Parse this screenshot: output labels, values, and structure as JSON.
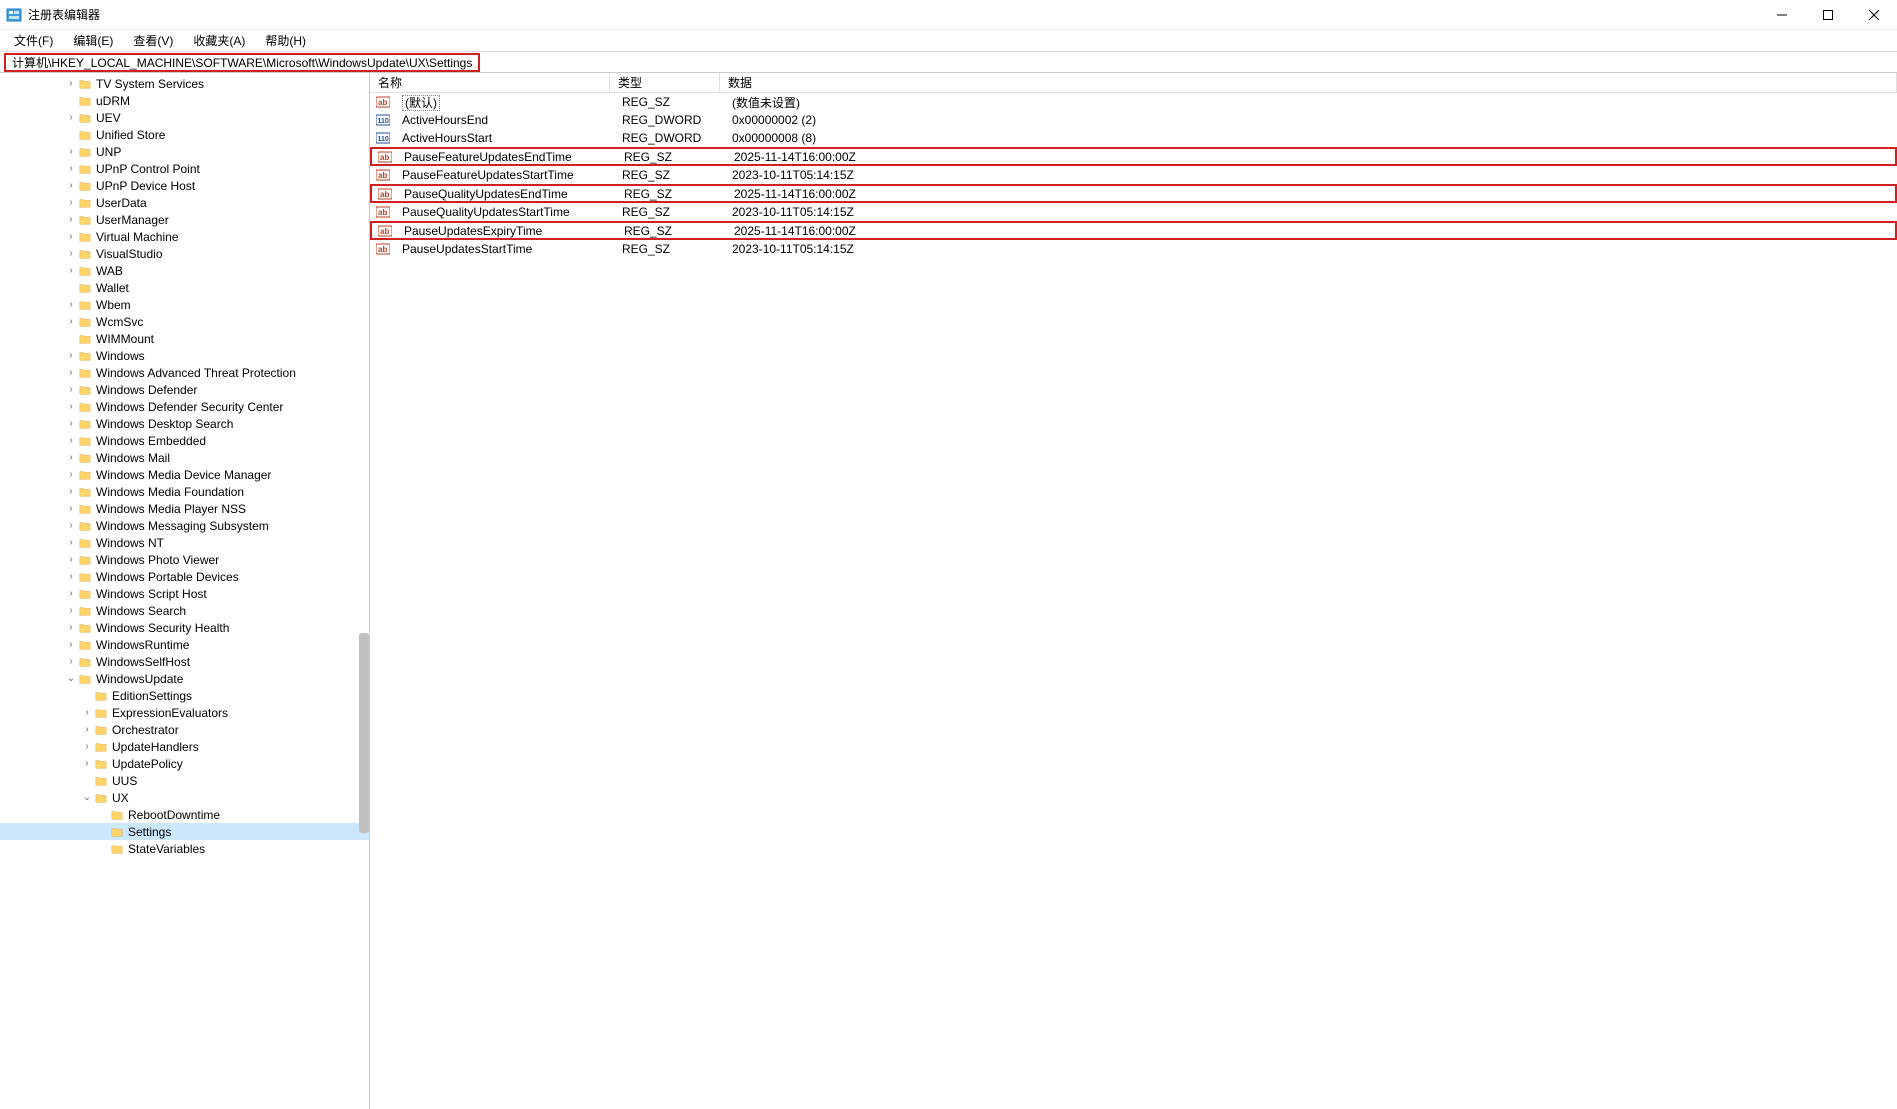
{
  "window": {
    "title": "注册表编辑器"
  },
  "menu": {
    "file": "文件(F)",
    "edit": "编辑(E)",
    "view": "查看(V)",
    "favorites": "收藏夹(A)",
    "help": "帮助(H)"
  },
  "address": {
    "path": "计算机\\HKEY_LOCAL_MACHINE\\SOFTWARE\\Microsoft\\WindowsUpdate\\UX\\Settings"
  },
  "tree": [
    {
      "indent": 4,
      "exp": ">",
      "label": "TV System Services"
    },
    {
      "indent": 4,
      "exp": "",
      "label": "uDRM"
    },
    {
      "indent": 4,
      "exp": ">",
      "label": "UEV"
    },
    {
      "indent": 4,
      "exp": "",
      "label": "Unified Store"
    },
    {
      "indent": 4,
      "exp": ">",
      "label": "UNP"
    },
    {
      "indent": 4,
      "exp": ">",
      "label": "UPnP Control Point"
    },
    {
      "indent": 4,
      "exp": ">",
      "label": "UPnP Device Host"
    },
    {
      "indent": 4,
      "exp": ">",
      "label": "UserData"
    },
    {
      "indent": 4,
      "exp": ">",
      "label": "UserManager"
    },
    {
      "indent": 4,
      "exp": ">",
      "label": "Virtual Machine"
    },
    {
      "indent": 4,
      "exp": ">",
      "label": "VisualStudio"
    },
    {
      "indent": 4,
      "exp": ">",
      "label": "WAB"
    },
    {
      "indent": 4,
      "exp": "",
      "label": "Wallet"
    },
    {
      "indent": 4,
      "exp": ">",
      "label": "Wbem"
    },
    {
      "indent": 4,
      "exp": ">",
      "label": "WcmSvc"
    },
    {
      "indent": 4,
      "exp": "",
      "label": "WIMMount"
    },
    {
      "indent": 4,
      "exp": ">",
      "label": "Windows"
    },
    {
      "indent": 4,
      "exp": ">",
      "label": "Windows Advanced Threat Protection"
    },
    {
      "indent": 4,
      "exp": ">",
      "label": "Windows Defender"
    },
    {
      "indent": 4,
      "exp": ">",
      "label": "Windows Defender Security Center"
    },
    {
      "indent": 4,
      "exp": ">",
      "label": "Windows Desktop Search"
    },
    {
      "indent": 4,
      "exp": ">",
      "label": "Windows Embedded"
    },
    {
      "indent": 4,
      "exp": ">",
      "label": "Windows Mail"
    },
    {
      "indent": 4,
      "exp": ">",
      "label": "Windows Media Device Manager"
    },
    {
      "indent": 4,
      "exp": ">",
      "label": "Windows Media Foundation"
    },
    {
      "indent": 4,
      "exp": ">",
      "label": "Windows Media Player NSS"
    },
    {
      "indent": 4,
      "exp": ">",
      "label": "Windows Messaging Subsystem"
    },
    {
      "indent": 4,
      "exp": ">",
      "label": "Windows NT"
    },
    {
      "indent": 4,
      "exp": ">",
      "label": "Windows Photo Viewer"
    },
    {
      "indent": 4,
      "exp": ">",
      "label": "Windows Portable Devices"
    },
    {
      "indent": 4,
      "exp": ">",
      "label": "Windows Script Host"
    },
    {
      "indent": 4,
      "exp": ">",
      "label": "Windows Search"
    },
    {
      "indent": 4,
      "exp": ">",
      "label": "Windows Security Health"
    },
    {
      "indent": 4,
      "exp": ">",
      "label": "WindowsRuntime"
    },
    {
      "indent": 4,
      "exp": ">",
      "label": "WindowsSelfHost"
    },
    {
      "indent": 4,
      "exp": "v",
      "label": "WindowsUpdate"
    },
    {
      "indent": 5,
      "exp": "",
      "label": "EditionSettings"
    },
    {
      "indent": 5,
      "exp": ">",
      "label": "ExpressionEvaluators"
    },
    {
      "indent": 5,
      "exp": ">",
      "label": "Orchestrator"
    },
    {
      "indent": 5,
      "exp": ">",
      "label": "UpdateHandlers"
    },
    {
      "indent": 5,
      "exp": ">",
      "label": "UpdatePolicy"
    },
    {
      "indent": 5,
      "exp": "",
      "label": "UUS"
    },
    {
      "indent": 5,
      "exp": "v",
      "label": "UX"
    },
    {
      "indent": 6,
      "exp": "",
      "label": "RebootDowntime"
    },
    {
      "indent": 6,
      "exp": "",
      "label": "Settings",
      "selected": true
    },
    {
      "indent": 6,
      "exp": "",
      "label": "StateVariables"
    }
  ],
  "columns": {
    "name": "名称",
    "type": "类型",
    "data": "数据"
  },
  "values": [
    {
      "icon": "sz",
      "name": "(默认)",
      "type": "REG_SZ",
      "data": "(数值未设置)",
      "isDefault": true
    },
    {
      "icon": "dword",
      "name": "ActiveHoursEnd",
      "type": "REG_DWORD",
      "data": "0x00000002 (2)"
    },
    {
      "icon": "dword",
      "name": "ActiveHoursStart",
      "type": "REG_DWORD",
      "data": "0x00000008 (8)"
    },
    {
      "icon": "sz",
      "name": "PauseFeatureUpdatesEndTime",
      "type": "REG_SZ",
      "data": "2025-11-14T16:00:00Z",
      "hl": true
    },
    {
      "icon": "sz",
      "name": "PauseFeatureUpdatesStartTime",
      "type": "REG_SZ",
      "data": "2023-10-11T05:14:15Z"
    },
    {
      "icon": "sz",
      "name": "PauseQualityUpdatesEndTime",
      "type": "REG_SZ",
      "data": "2025-11-14T16:00:00Z",
      "hl": true
    },
    {
      "icon": "sz",
      "name": "PauseQualityUpdatesStartTime",
      "type": "REG_SZ",
      "data": "2023-10-11T05:14:15Z"
    },
    {
      "icon": "sz",
      "name": "PauseUpdatesExpiryTime",
      "type": "REG_SZ",
      "data": "2025-11-14T16:00:00Z",
      "hl": true
    },
    {
      "icon": "sz",
      "name": "PauseUpdatesStartTime",
      "type": "REG_SZ",
      "data": "2023-10-11T05:14:15Z"
    }
  ]
}
